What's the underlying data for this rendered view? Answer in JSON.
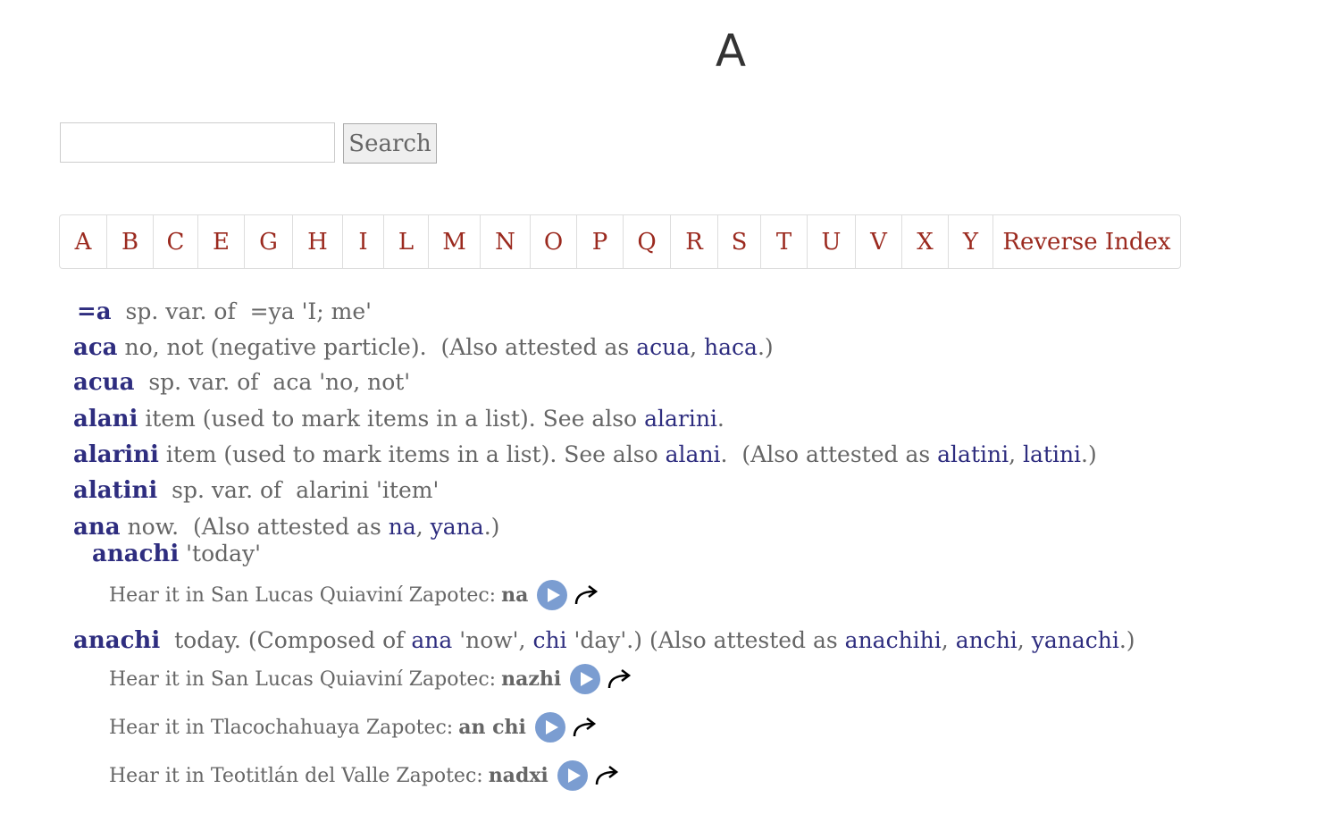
{
  "title": "A",
  "search": {
    "placeholder": "",
    "button_label": "Search"
  },
  "nav": [
    "A",
    "B",
    "C",
    "E",
    "G",
    "H",
    "I",
    "L",
    "M",
    "N",
    "O",
    "P",
    "Q",
    "R",
    "S",
    "T",
    "U",
    "V",
    "X",
    "Y",
    "Reverse Index"
  ],
  "entries": {
    "e1": {
      "hw": "=a",
      "pre": "sp. var. of",
      "ref": "=ya",
      "gloss": "'I; me'"
    },
    "e2": {
      "hw": "aca",
      "def": "no, not (negative particle).",
      "also": "(Also attested as",
      "a1": "acua",
      "sep": ",",
      "a2": "haca",
      "end": ".)"
    },
    "e3": {
      "hw": "acua",
      "pre": "sp. var. of",
      "ref": "aca",
      "gloss": "'no, not'"
    },
    "e4": {
      "hw": "alani",
      "def": "item (used to mark items in a list). See also",
      "a1": "alarini",
      "end": "."
    },
    "e5": {
      "hw": "alarini",
      "def": "item (used to mark items in a list). See also",
      "a1": "alani",
      "dot": ".",
      "also": "(Also attested as",
      "a2": "alatini",
      "sep": ",",
      "a3": "latini",
      "end": ".)"
    },
    "e6": {
      "hw": "alatini",
      "pre": "sp. var. of",
      "ref": "alarini",
      "gloss": "'item'"
    },
    "e7": {
      "hw": "ana",
      "def": "now.",
      "also": "(Also attested as",
      "a1": "na",
      "sep": ",",
      "a2": "yana",
      "end": ".)"
    },
    "e8": {
      "hw": "anachi",
      "gloss": "'today'"
    },
    "e9": {
      "hw": "anachi",
      "def": "today. (Composed of",
      "c1": "ana",
      "g1": "'now',",
      "c2": "chi",
      "g2": "'day'.)",
      "also": "(Also attested as",
      "a1": "anachihi",
      "a2": "anchi",
      "a3": "yanachi",
      "sep": ",",
      "end": ".)"
    }
  },
  "hear": [
    {
      "label": "Hear it in San Lucas Quiaviní Zapotec:",
      "word": "na"
    },
    {
      "label": "Hear it in San Lucas Quiaviní Zapotec:",
      "word": "nazhi"
    },
    {
      "label": "Hear it in Tlacochahuaya Zapotec:",
      "word": "an chi"
    },
    {
      "label": "Hear it in Teotitlán del Valle Zapotec:",
      "word": "nadxi"
    }
  ]
}
